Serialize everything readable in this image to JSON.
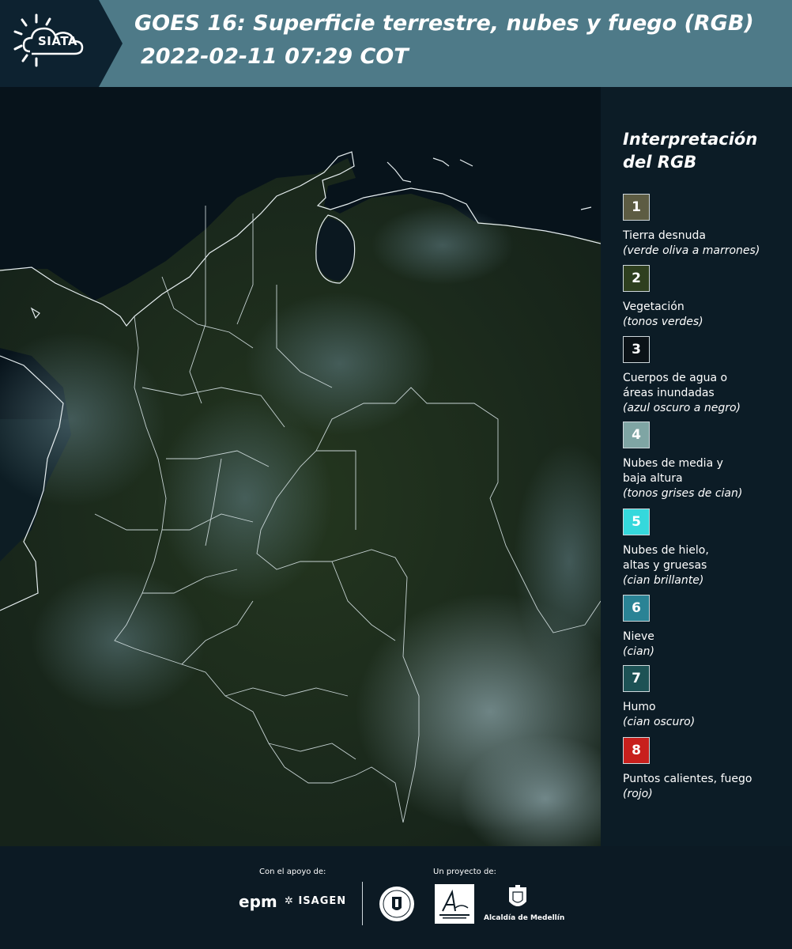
{
  "header": {
    "logo_text": "SIATA",
    "title_line1": "GOES 16: Superficie terrestre, nubes y fuego (RGB)",
    "title_line2": "2022-02-11 07:29 COT"
  },
  "map": {
    "icon": "satellite-map-colombia"
  },
  "legend": {
    "title": "Interpretación del RGB",
    "items": [
      {
        "num": "1",
        "color": "#5d5c43",
        "label": "Tierra desnuda",
        "sub": "(verde oliva a marrones)"
      },
      {
        "num": "2",
        "color": "#2e3f1f",
        "label": "Vegetación",
        "sub": "(tonos verdes)"
      },
      {
        "num": "3",
        "color": "#0b1217",
        "label": "Cuerpos de agua o áreas inundadas",
        "sub": "(azul oscuro a negro)"
      },
      {
        "num": "4",
        "color": "#7fa5a4",
        "label": "Nubes de media y baja altura",
        "sub": "(tonos grises de cian)"
      },
      {
        "num": "5",
        "color": "#35d8dc",
        "label": "Nubes de hielo, altas y gruesas",
        "sub": "(cian brillante)"
      },
      {
        "num": "6",
        "color": "#2a8395",
        "label": "Nieve",
        "sub": "(cian)"
      },
      {
        "num": "7",
        "color": "#1d5255",
        "label": "Humo",
        "sub": "(cian oscuro)"
      },
      {
        "num": "8",
        "color": "#c8201d",
        "label": "Puntos calientes, fuego",
        "sub": "(rojo)"
      }
    ]
  },
  "footer": {
    "support_label": "Con el apoyo de:",
    "project_label": "Un proyecto de:",
    "epm": "epm",
    "isagen": "ISAGEN",
    "alcaldia": "Alcaldía de Medellín"
  }
}
